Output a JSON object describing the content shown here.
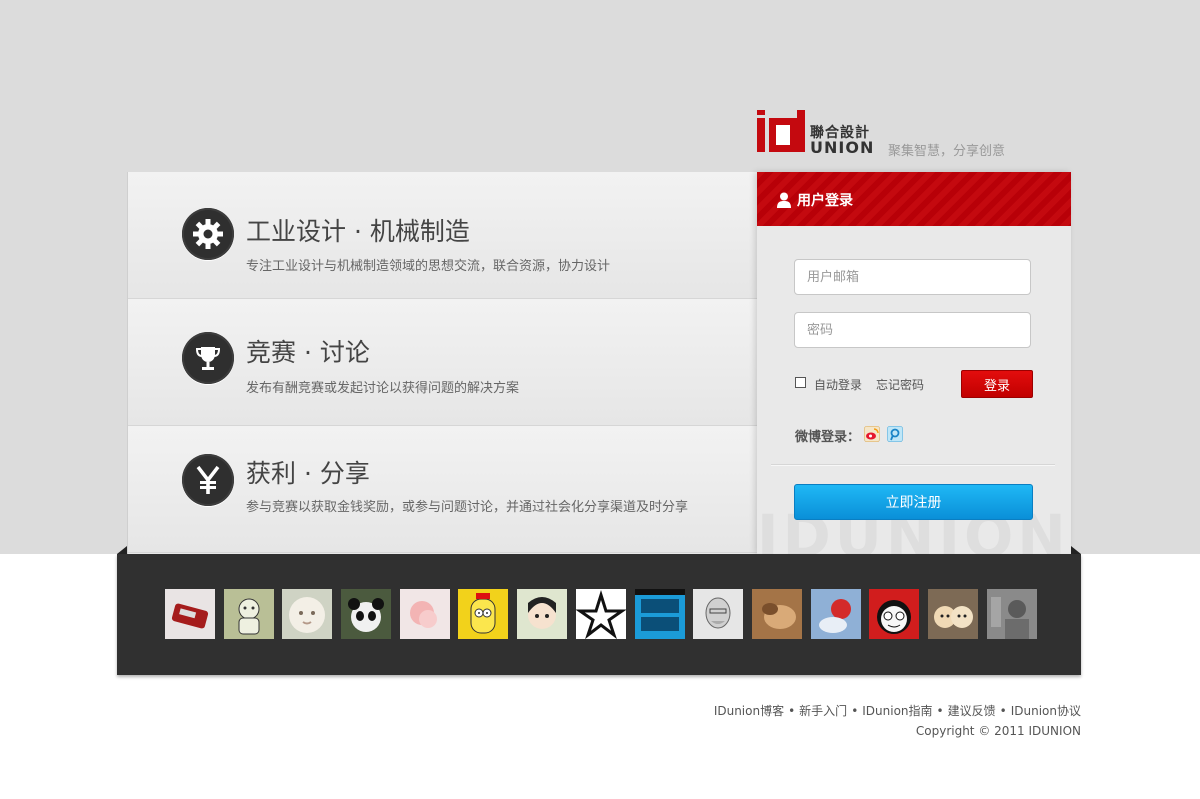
{
  "logo": {
    "mark": "ID",
    "cn_name": "聯合設計",
    "en_name": "UNION",
    "tagline": "聚集智慧，分享创意"
  },
  "features": [
    {
      "title": "工业设计 · 机械制造",
      "desc": "专注工业设计与机械制造领域的思想交流，联合资源，协力设计",
      "icon": "gear-icon"
    },
    {
      "title": "竞赛 · 讨论",
      "desc": "发布有酬竞赛或发起讨论以获得问题的解决方案",
      "icon": "trophy-icon"
    },
    {
      "title": "获利 · 分享",
      "desc": "参与竞赛以获取金钱奖励，或参与问题讨论，并通过社会化分享渠道及时分享",
      "icon": "yen-icon"
    }
  ],
  "login": {
    "title": "用户登录",
    "email_placeholder": "用户邮箱",
    "password_placeholder": "密码",
    "auto_login": "自动登录",
    "forgot_password": "忘记密码",
    "login_button": "登录",
    "weibo_label": "微博登录：",
    "register_button": "立即注册",
    "watermark": "IDUNION"
  },
  "avatars": [
    {
      "name": "avatar-red-device",
      "color": "#b8a9a9"
    },
    {
      "name": "avatar-cartoon-creature",
      "color": "#9aa07c"
    },
    {
      "name": "avatar-white-lion",
      "color": "#d9d4c6"
    },
    {
      "name": "avatar-panda",
      "color": "#4b5a3e"
    },
    {
      "name": "avatar-pink-flower",
      "color": "#e9cfcf"
    },
    {
      "name": "avatar-simpsons",
      "color": "#f2d21b"
    },
    {
      "name": "avatar-anime-girl",
      "color": "#d9e0c8"
    },
    {
      "name": "avatar-socialism-star",
      "color": "#ffffff"
    },
    {
      "name": "avatar-flow-jug",
      "color": "#1b9bd8"
    },
    {
      "name": "avatar-sketch-man",
      "color": "#cfcfcf"
    },
    {
      "name": "avatar-warm-photo",
      "color": "#c59a68"
    },
    {
      "name": "avatar-blue-red-toy",
      "color": "#7d9dc4"
    },
    {
      "name": "avatar-cartoon-face",
      "color": "#d11d1d"
    },
    {
      "name": "avatar-puppies",
      "color": "#c9b08e"
    },
    {
      "name": "avatar-grey-photo",
      "color": "#777777"
    }
  ],
  "footer": {
    "links": [
      "IDunion博客",
      "新手入门",
      "IDunion指南",
      "建议反馈",
      "IDunion协议"
    ],
    "separator": "•",
    "copyright": "Copyright © 2011 IDUNION"
  },
  "colors": {
    "brand_red": "#c4090f",
    "register_blue": "#0a8fd8",
    "dark_bar": "#303030"
  }
}
